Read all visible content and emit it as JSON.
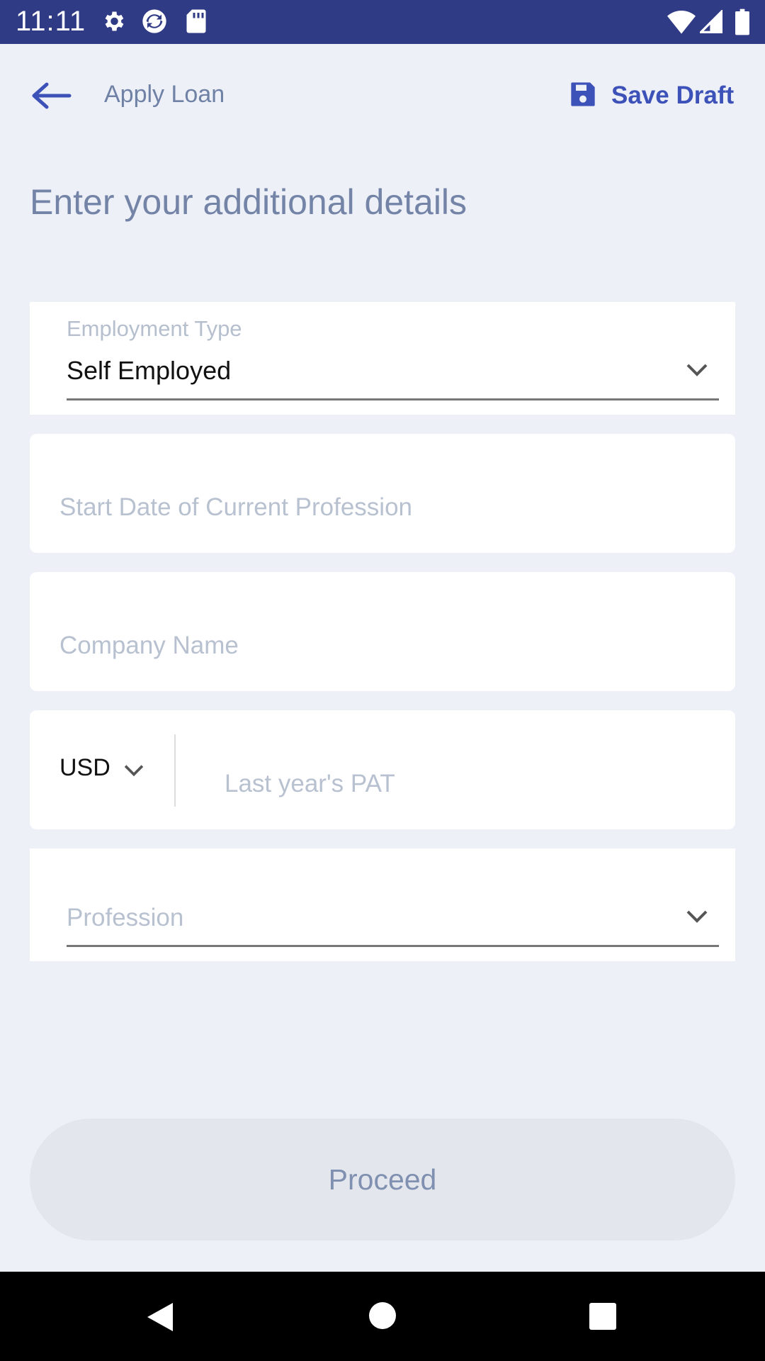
{
  "status_bar": {
    "time": "11:11",
    "left_icons": [
      "gear-icon",
      "sync-icon",
      "sd-card-icon"
    ],
    "right_icons": [
      "wifi-icon",
      "signal-icon",
      "battery-icon"
    ]
  },
  "header": {
    "back_icon": "arrow-left-icon",
    "title": "Apply Loan",
    "save_icon": "floppy-disk-icon",
    "save_label": "Save Draft"
  },
  "page_title": "Enter your additional details",
  "form": {
    "employment_type": {
      "label": "Employment Type",
      "value": "Self Employed"
    },
    "start_date": {
      "placeholder": "Start Date of Current Profession"
    },
    "company_name": {
      "placeholder": "Company Name"
    },
    "pat": {
      "currency": "USD",
      "placeholder": "Last year's PAT"
    },
    "profession": {
      "placeholder": "Profession"
    }
  },
  "proceed_label": "Proceed",
  "nav_bar": [
    "back-triangle-icon",
    "home-circle-icon",
    "recents-square-icon"
  ],
  "colors": {
    "status_bar": "#303b86",
    "accent": "#3d52b8",
    "background": "#eef0f8",
    "disabled_button": "#e3e6ec"
  }
}
